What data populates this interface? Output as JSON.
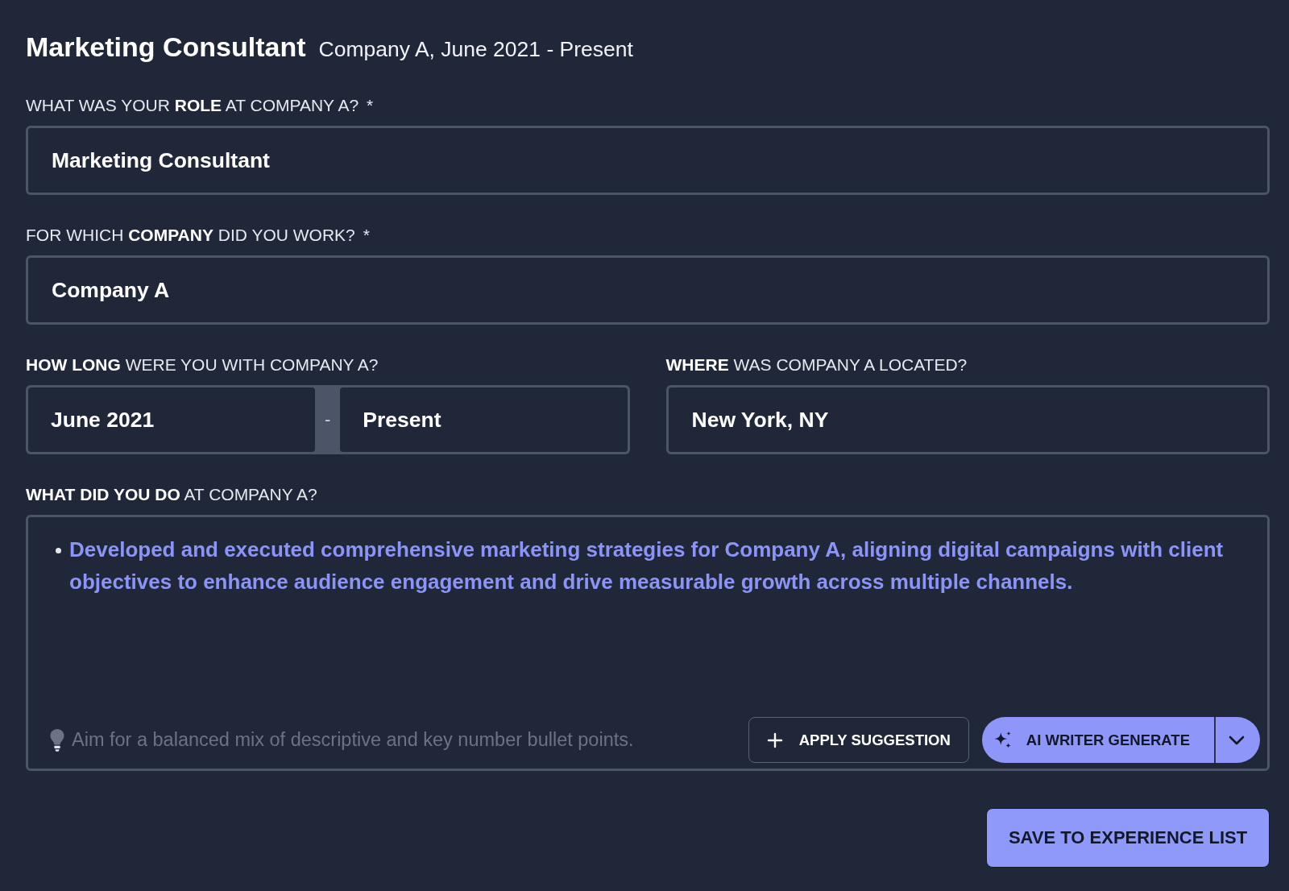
{
  "header": {
    "title": "Marketing Consultant",
    "subtitle": "Company A, June 2021 - Present"
  },
  "role": {
    "label": "WHAT WAS YOUR **ROLE** AT COMPANY A?",
    "required_mark": "*",
    "value": "Marketing Consultant"
  },
  "company": {
    "label": "FOR WHICH **COMPANY** DID YOU WORK?",
    "required_mark": "*",
    "value": "Company A"
  },
  "duration": {
    "label": "**HOW LONG** WERE YOU WITH COMPANY A?",
    "start": "June 2021",
    "separator": "-",
    "end": "Present"
  },
  "location": {
    "label": "**WHERE** WAS COMPANY A LOCATED?",
    "value": "New York, NY"
  },
  "description": {
    "label": "**WHAT DID YOU DO** AT COMPANY A?",
    "bullets": [
      "Developed and executed comprehensive marketing strategies for Company A, aligning digital campaigns with client objectives to enhance audience engagement and drive measurable growth across multiple channels."
    ],
    "hint": "Aim for a balanced mix of descriptive and key number bullet points.",
    "buttons": [
      {
        "kind": "outline",
        "label": "APPLY SUGGESTION"
      },
      {
        "kind": "split",
        "label": "AI WRITER GENERATE"
      }
    ]
  },
  "save_button": {
    "label": "SAVE TO EXPERIENCE LIST"
  }
}
